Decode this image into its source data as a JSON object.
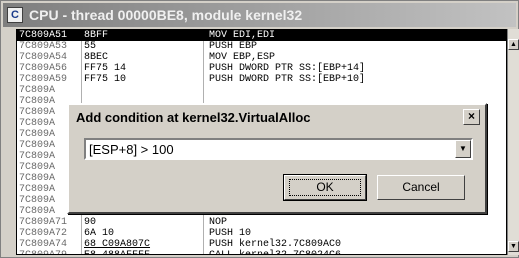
{
  "window": {
    "icon_letter": "C",
    "title": "CPU - thread 00000BE8, module kernel32"
  },
  "disasm_rows": [
    {
      "addr": "7C809A51",
      "hex": "8BFF",
      "dis": "MOV EDI,EDI",
      "selected": true
    },
    {
      "addr": "7C809A53",
      "hex": "55",
      "dis": "PUSH EBP"
    },
    {
      "addr": "7C809A54",
      "hex": "8BEC",
      "dis": "MOV EBP,ESP"
    },
    {
      "addr": "7C809A56",
      "hex": "FF75 14",
      "dis": "PUSH DWORD PTR SS:[EBP+14]"
    },
    {
      "addr": "7C809A59",
      "hex": "FF75 10",
      "dis": "PUSH DWORD PTR SS:[EBP+10]"
    },
    {
      "addr": "7C809A",
      "hex": "",
      "dis": ""
    },
    {
      "addr": "7C809A",
      "hex": "",
      "dis": ""
    },
    {
      "addr": "7C809A",
      "hex": "",
      "dis": ""
    },
    {
      "addr": "7C809A",
      "hex": "",
      "dis": ""
    },
    {
      "addr": "7C809A",
      "hex": "",
      "dis": ""
    },
    {
      "addr": "7C809A",
      "hex": "",
      "dis": ""
    },
    {
      "addr": "7C809A",
      "hex": "",
      "dis": ""
    },
    {
      "addr": "7C809A",
      "hex": "",
      "dis": ""
    },
    {
      "addr": "7C809A",
      "hex": "",
      "dis": ""
    },
    {
      "addr": "7C809A",
      "hex": "",
      "dis": ""
    },
    {
      "addr": "7C809A",
      "hex": "",
      "dis": ""
    },
    {
      "addr": "7C809A",
      "hex": "",
      "dis": ""
    },
    {
      "addr": "7C809A71",
      "hex": "90",
      "dis": "NOP"
    },
    {
      "addr": "7C809A72",
      "hex": "6A 10",
      "dis": "PUSH 10"
    },
    {
      "addr": "7C809A74",
      "hex": "68 C09A807C",
      "dis": "PUSH kernel32.7C809AC0",
      "underline_hex": true
    },
    {
      "addr": "7C809A79",
      "hex": "E8 488AFFFF",
      "dis": "CALL kernel32.7C8024C6",
      "underline_hex": true
    }
  ],
  "dialog": {
    "title": "Add condition at kernel32.VirtualAlloc",
    "close_glyph": "×",
    "condition_value": "[ESP+8] > 100",
    "ok_label": "OK",
    "cancel_label": "Cancel"
  },
  "colors": {
    "titlebar": "#7e7e7e",
    "selection": "#000000",
    "dialog_bg": "#d4d0c8"
  }
}
